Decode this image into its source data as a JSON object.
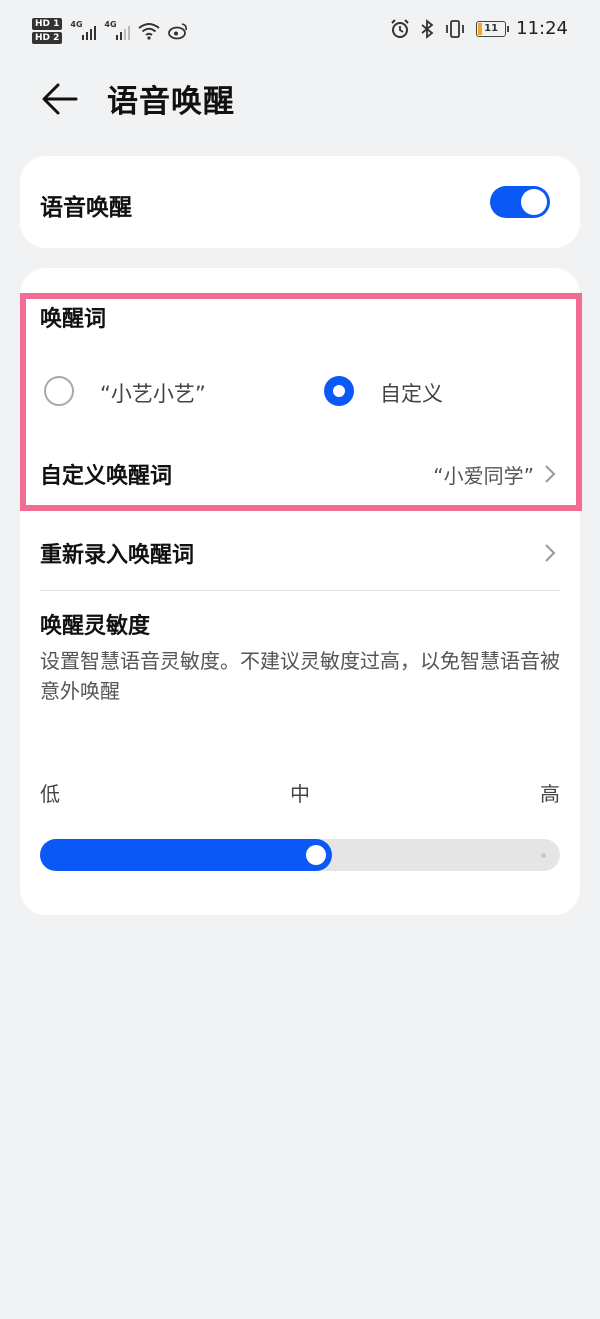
{
  "status_bar": {
    "sim1": "HD 1",
    "sim2": "HD 2",
    "net1": "4G",
    "net2": "4G",
    "battery_level": "11",
    "time": "11:24",
    "icons": [
      "wifi-icon",
      "weibo-icon",
      "alarm-icon",
      "bluetooth-icon",
      "vibrate-icon",
      "battery-icon"
    ]
  },
  "header": {
    "title": "语音唤醒",
    "back_icon": "back-arrow-icon"
  },
  "voice_wake": {
    "label": "语音唤醒",
    "enabled": true
  },
  "wake_word": {
    "section_title": "唤醒词",
    "options": [
      {
        "label": "“小艺小艺”",
        "selected": false
      },
      {
        "label": "自定义",
        "selected": true
      }
    ],
    "custom_label": "自定义唤醒词",
    "custom_value": "“小爱同学”"
  },
  "rerecord": {
    "label": "重新录入唤醒词"
  },
  "sensitivity": {
    "title": "唤醒灵敏度",
    "description": "设置智慧语音灵敏度。不建议灵敏度过高，以免智慧语音被意外唤醒",
    "levels": [
      "低",
      "中",
      "高"
    ],
    "value_fraction": 0.53
  },
  "colors": {
    "accent": "#0a59f7",
    "highlight_border": "#f26d94",
    "background": "#f1f2f4"
  }
}
